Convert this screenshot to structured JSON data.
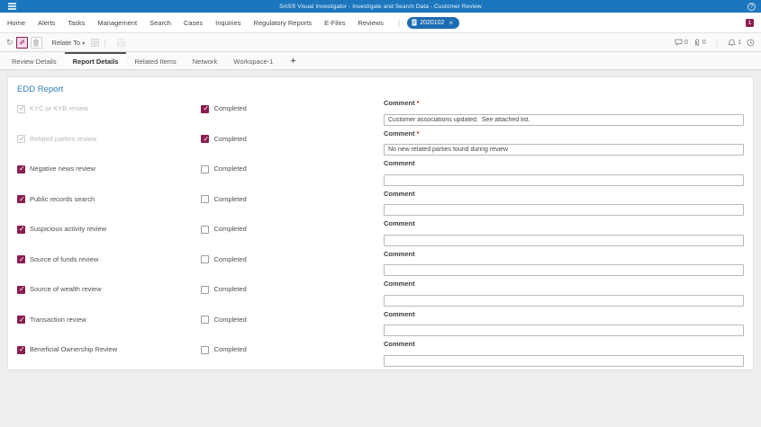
{
  "app": {
    "title": "SAS® Visual Investigator - Investigate and Search Data - Customer Review"
  },
  "nav": {
    "items": [
      "Home",
      "Alerts",
      "Tasks",
      "Management",
      "Search",
      "Cases",
      "Inquiries",
      "Regulatory Reports",
      "E-Files",
      "Reviews"
    ],
    "open_tab": {
      "label": "2020102",
      "close": "×"
    },
    "badge_count": "1"
  },
  "toolbar": {
    "relate_to_label": "Relate To",
    "comments_count": "0",
    "attachments_count": "0",
    "notifications_count": "1"
  },
  "tabs": {
    "items": [
      "Review Details",
      "Report Details",
      "Related Items",
      "Network",
      "Workspace-1"
    ],
    "active_index": 1,
    "add_label": "+"
  },
  "report": {
    "title": "EDD Report",
    "completed_label": "Completed",
    "comment_label": "Comment",
    "rows": [
      {
        "label": "KYC or KYB review",
        "checked": true,
        "disabled": true,
        "completed": true,
        "comment_required": true,
        "comment_value": "Customer associations updated.  See attached list."
      },
      {
        "label": "Related parties review",
        "checked": true,
        "disabled": true,
        "completed": true,
        "comment_required": true,
        "comment_value": "No new related parties found during review"
      },
      {
        "label": "Negative news review",
        "checked": true,
        "disabled": false,
        "completed": false,
        "comment_required": false,
        "comment_value": ""
      },
      {
        "label": "Public records search",
        "checked": true,
        "disabled": false,
        "completed": false,
        "comment_required": false,
        "comment_value": ""
      },
      {
        "label": "Suspicious activity review",
        "checked": true,
        "disabled": false,
        "completed": false,
        "comment_required": false,
        "comment_value": ""
      },
      {
        "label": "Source of funds review",
        "checked": true,
        "disabled": false,
        "completed": false,
        "comment_required": false,
        "comment_value": ""
      },
      {
        "label": "Source of wealth review",
        "checked": true,
        "disabled": false,
        "completed": false,
        "comment_required": false,
        "comment_value": ""
      },
      {
        "label": "Transaction review",
        "checked": true,
        "disabled": false,
        "completed": false,
        "comment_required": false,
        "comment_value": ""
      },
      {
        "label": "Beneficial Ownership Review",
        "checked": true,
        "disabled": false,
        "completed": false,
        "comment_required": false,
        "comment_value": ""
      }
    ]
  },
  "colors": {
    "topbar_blue": "#1b76bd",
    "pill_blue": "#1d6cb2",
    "accent_maroon": "#8a1e52",
    "heading_blue": "#2e7cb8"
  }
}
